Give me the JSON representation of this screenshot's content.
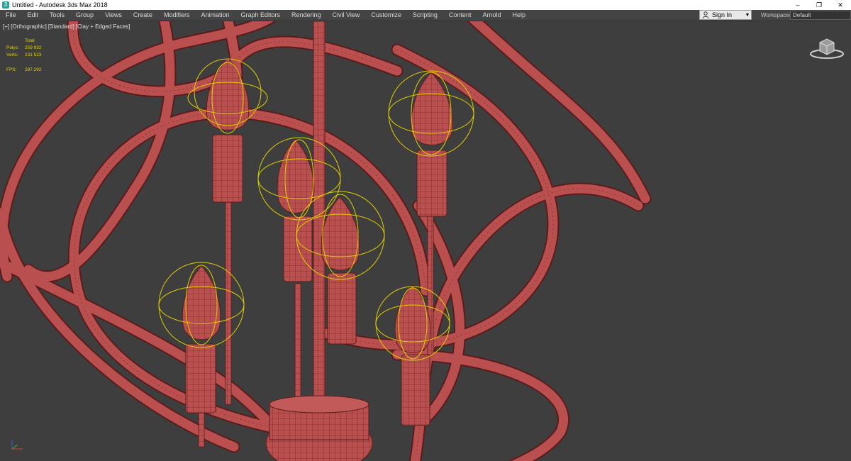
{
  "window": {
    "title": "Untitled - Autodesk 3ds Max 2018",
    "controls": {
      "minimize": "–",
      "restore": "❐",
      "close": "✕"
    }
  },
  "menu": {
    "items": [
      "File",
      "Edit",
      "Tools",
      "Group",
      "Views",
      "Create",
      "Modifiers",
      "Animation",
      "Graph Editors",
      "Rendering",
      "Civil View",
      "Customize",
      "Scripting",
      "Content",
      "Arnold",
      "Help"
    ]
  },
  "account": {
    "sign_in": "Sign In"
  },
  "workspaces": {
    "label": "Workspaces:",
    "value": "Default"
  },
  "viewport": {
    "labels": [
      "[+]",
      "[Orthographic]",
      "[Standard]",
      "[Clay + Edged Faces]"
    ],
    "stats": {
      "header": "Total",
      "polys_label": "Polys:",
      "polys_value": "259 932",
      "verts_label": "Verts:",
      "verts_value": "131 523",
      "fps_label": "FPS:",
      "fps_value": "297.292"
    }
  },
  "colors": {
    "model": "#b9504f",
    "wire": "#5a1c1b",
    "gizmo": "#e0d000",
    "viewport_bg": "#3e3e3e",
    "ui_bg": "#444444"
  },
  "icons": {
    "app": "3ds-max-icon",
    "user": "person-icon",
    "viewcube": "viewcube-icon",
    "axis": "axis-tripod-icon"
  }
}
